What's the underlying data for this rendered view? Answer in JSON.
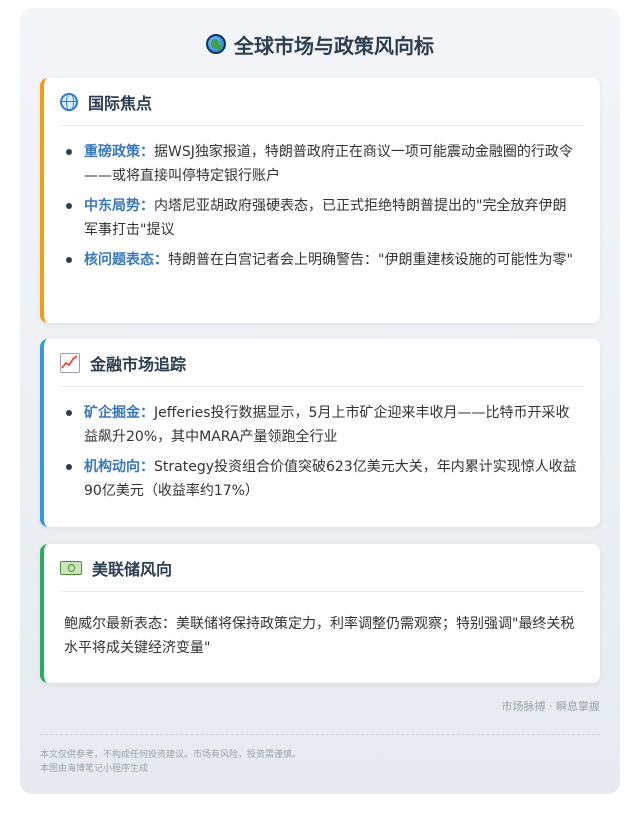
{
  "header": {
    "icon": "globe-icon",
    "title": "全球市场与政策风向标"
  },
  "sections": [
    {
      "icon": "globe-with-meridians-icon",
      "accent": "#f39c12",
      "title": "国际焦点",
      "items": [
        {
          "label": "重磅政策：",
          "text": "据WSJ独家报道，特朗普政府正在商议一项可能震动金融圈的行政令——或将直接叫停特定银行账户"
        },
        {
          "label": "中东局势：",
          "text": "内塔尼亚胡政府强硬表态，已正式拒绝特朗普提出的\"完全放弃伊朗军事打击\"提议"
        },
        {
          "label": "核问题表态：",
          "text": "特朗普在白宫记者会上明确警告：\"伊朗重建核设施的可能性为零\""
        }
      ]
    },
    {
      "icon": "chart-increasing-icon",
      "accent": "#3498db",
      "title": "金融市场追踪",
      "items": [
        {
          "label": "矿企掘金：",
          "text": "Jefferies投行数据显示，5月上市矿企迎来丰收月——比特币开采收益飙升20%，其中MARA产量领跑全行业"
        },
        {
          "label": "机构动向：",
          "text": "Strategy投资组合价值突破623亿美元大关，年内累计实现惊人收益90亿美元（收益率约17%）"
        }
      ]
    },
    {
      "icon": "money-bill-icon",
      "accent": "#27ae60",
      "title": "美联储风向",
      "text": "鲍威尔最新表态：美联储将保持政策定力，利率调整仍需观察；特别强调\"最终关税水平将成关键经济变量\""
    }
  ],
  "brand": "市场脉搏 · 瞬息掌握",
  "footer": {
    "disclaimer": "本文仅供参考，不构成任何投资建议。市场有风险，投资需谨慎。",
    "generator": "本图由海博笔记小程序生成"
  }
}
